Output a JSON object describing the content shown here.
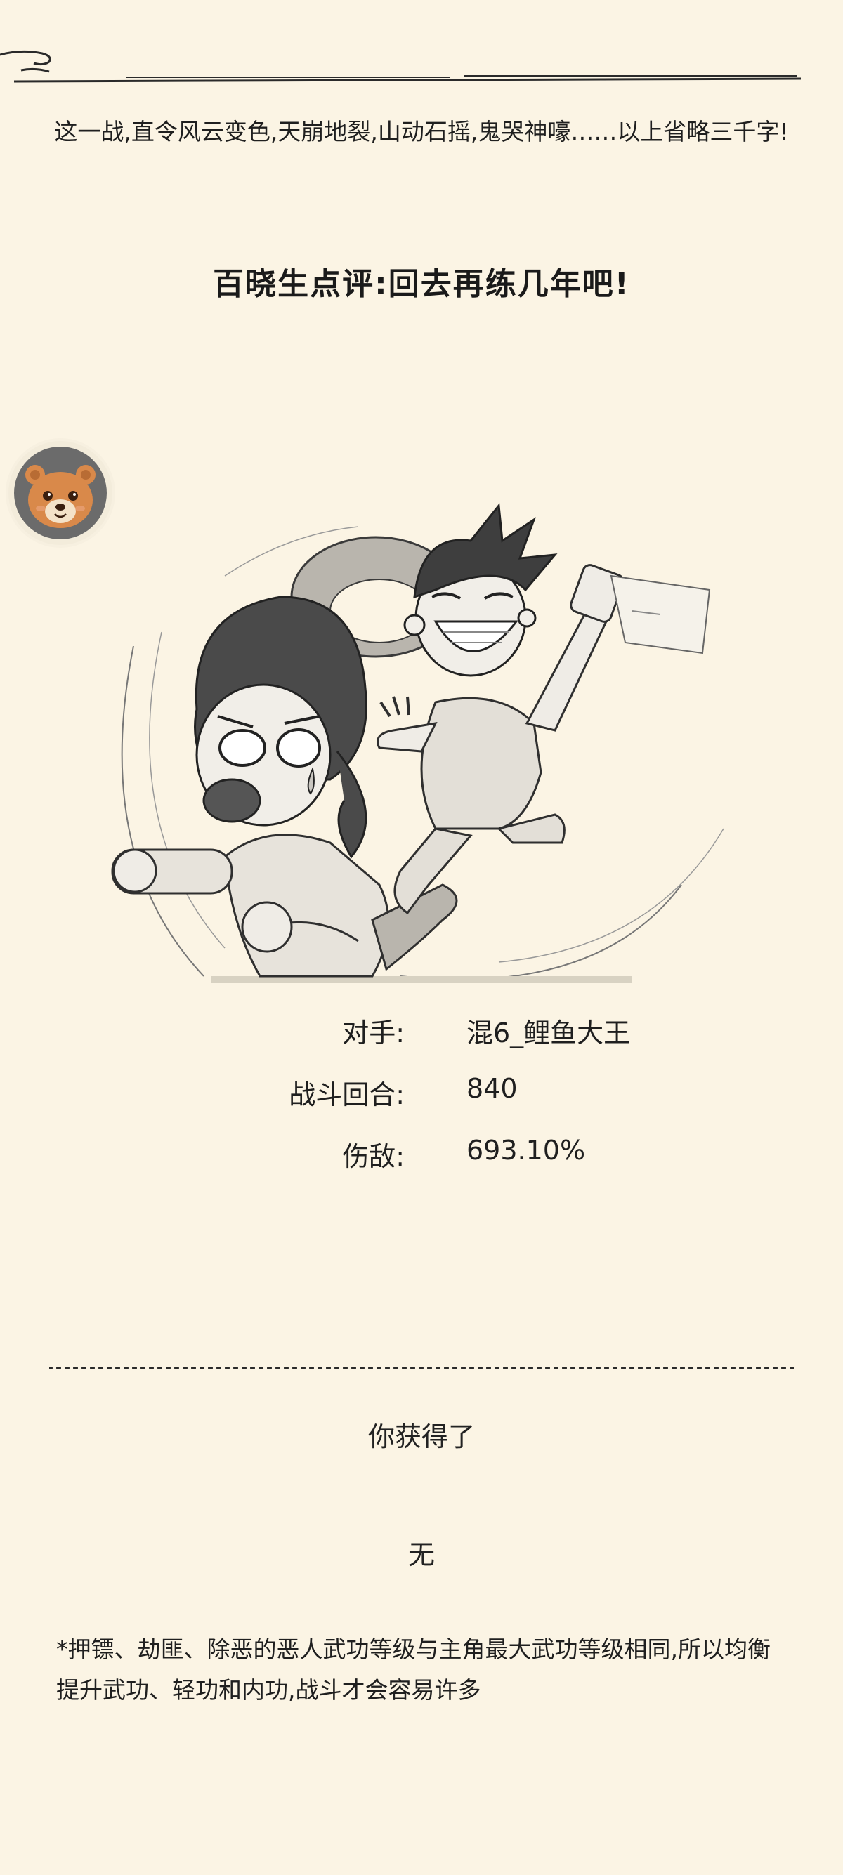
{
  "battle": {
    "intro": "这一战,直令风云变色,天崩地裂,山动石摇,鬼哭神嚎……以上省略三千字!",
    "comment": "百晓生点评:回去再练几年吧!"
  },
  "stats": [
    {
      "label": "对手:",
      "value": "混6_鲤鱼大王"
    },
    {
      "label": "战斗回合:",
      "value": "840"
    },
    {
      "label": "伤敌:",
      "value": "693.10%"
    }
  ],
  "reward": {
    "title": "你获得了",
    "value": "无"
  },
  "tip": "*押镖、劫匪、除恶的恶人武功等级与主角最大武功等级相同,所以均衡提升武功、轻功和内功,战斗才会容易许多",
  "colors": {
    "background": "#fbf4e4",
    "text": "#222222",
    "avatar_ring": "#6b6b6b",
    "avatar_bear": "#d9894a"
  },
  "icons": {
    "avatar": "bear-avatar-icon",
    "illustration": "battle-illustration"
  }
}
